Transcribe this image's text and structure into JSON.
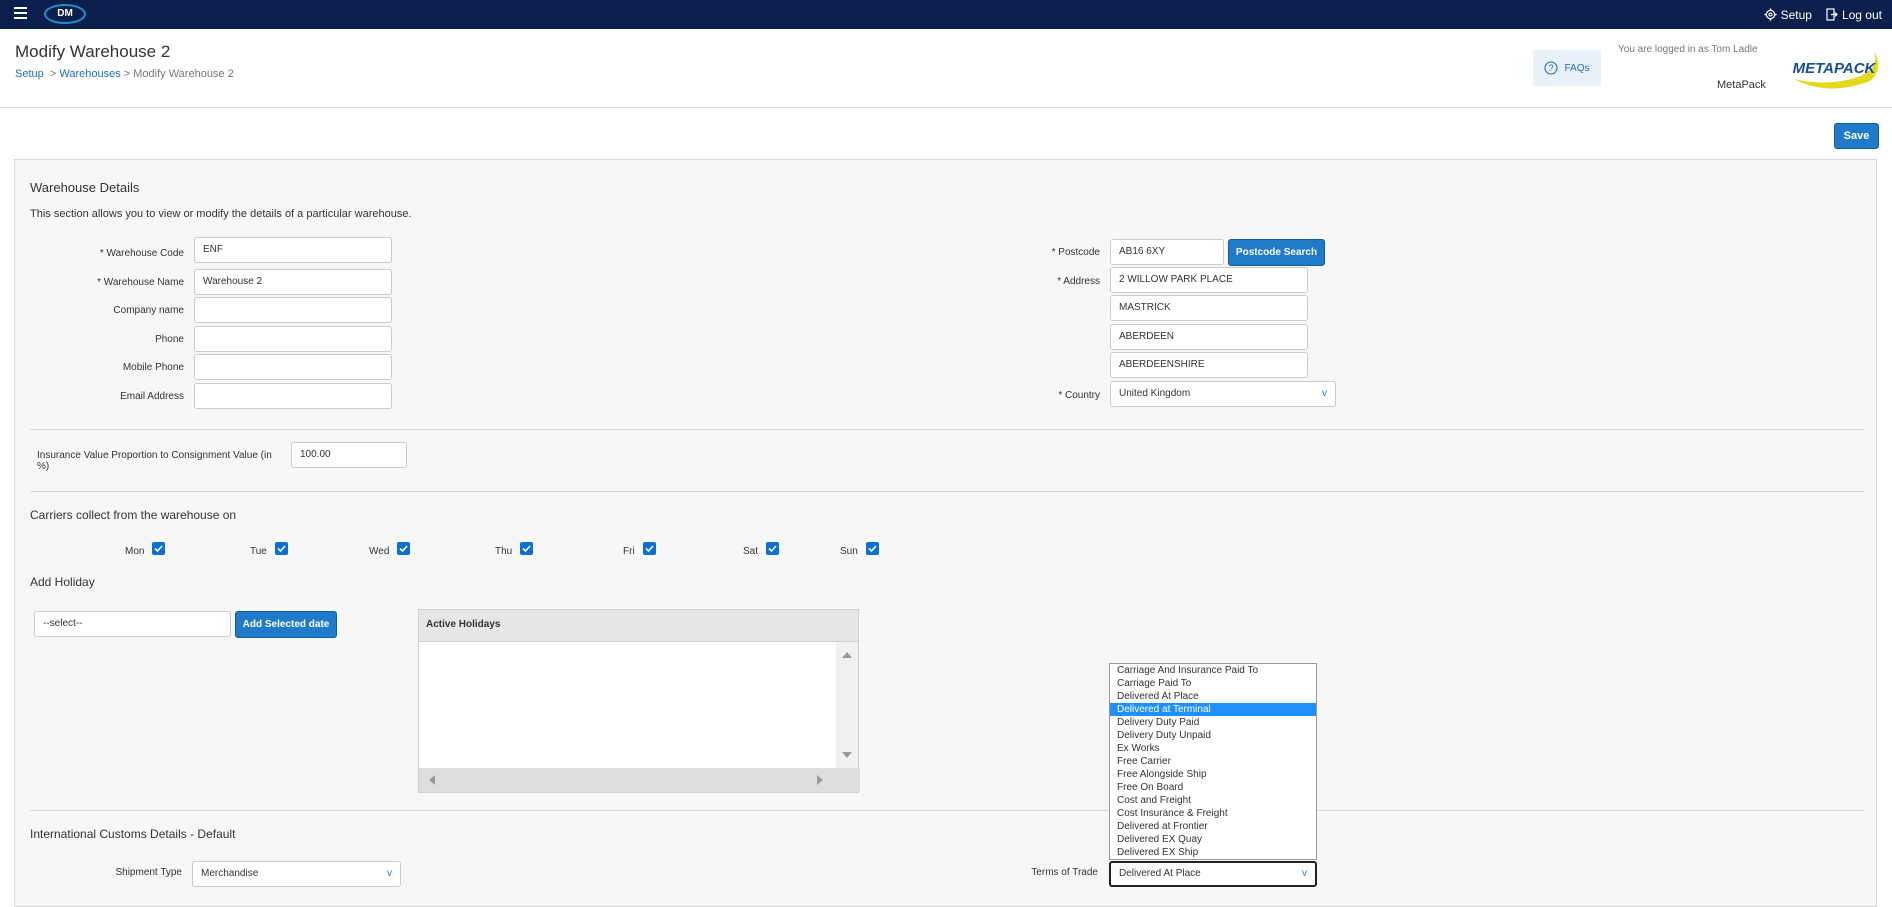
{
  "topbar": {
    "logo": "DM",
    "setup": "Setup",
    "logout": "Log out"
  },
  "header": {
    "title": "Modify Warehouse 2",
    "breadcrumb": [
      "Setup",
      "Warehouses",
      "Modify Warehouse 2"
    ],
    "faqs": "FAQs",
    "logged_in": "You are logged in as Tom Ladle",
    "company": "MetaPack",
    "brand": "METAPACK"
  },
  "save_label": "Save",
  "details": {
    "title": "Warehouse Details",
    "desc": "This section allows you to view or modify the details of a particular warehouse.",
    "fields": {
      "warehouse_code": {
        "label": "* Warehouse Code",
        "value": "ENF"
      },
      "warehouse_name": {
        "label": "* Warehouse Name",
        "value": "Warehouse 2"
      },
      "company_name": {
        "label": "Company name",
        "value": ""
      },
      "phone": {
        "label": "Phone",
        "value": ""
      },
      "mobile_phone": {
        "label": "Mobile Phone",
        "value": ""
      },
      "email": {
        "label": "Email Address",
        "value": ""
      }
    },
    "postcode": {
      "label": "* Postcode",
      "value": "AB16 6XY",
      "search": "Postcode Search"
    },
    "address": {
      "label": "* Address",
      "lines": [
        "2 WILLOW PARK PLACE",
        "MASTRICK",
        "ABERDEEN",
        "ABERDEENSHIRE"
      ]
    },
    "country": {
      "label": "* Country",
      "value": "United Kingdom"
    }
  },
  "insurance": {
    "label": "Insurance Value Proportion to Consignment Value (in %)",
    "value": "100.00"
  },
  "carriers": {
    "title": "Carriers collect from the warehouse on",
    "days": [
      "Mon",
      "Tue",
      "Wed",
      "Thu",
      "Fri",
      "Sat",
      "Sun"
    ]
  },
  "holiday": {
    "title": "Add Holiday",
    "select_value": "--select--",
    "add_button": "Add Selected date",
    "active_title": "Active Holidays"
  },
  "customs": {
    "title": "International Customs Details - Default",
    "shipment_type": {
      "label": "Shipment Type",
      "value": "Merchandise"
    },
    "terms_of_trade": {
      "label": "Terms of Trade",
      "value": "Delivered At Place",
      "highlighted": "Delivered at Terminal",
      "options": [
        "Carriage And Insurance Paid To",
        "Carriage Paid To",
        "Delivered At Place",
        "Delivered at Terminal",
        "Delivery Duty Paid",
        "Delivery Duty Unpaid",
        "Ex Works",
        "Free Carrier",
        "Free Alongside Ship",
        "Free On Board",
        "Cost and Freight",
        "Cost Insurance & Freight",
        "Delivered at Frontier",
        "Delivered EX Quay",
        "Delivered EX Ship"
      ]
    }
  },
  "colors": {
    "navbar": "#0b1f4d",
    "accent": "#1f7bc9",
    "highlight": "#1e90ff"
  }
}
